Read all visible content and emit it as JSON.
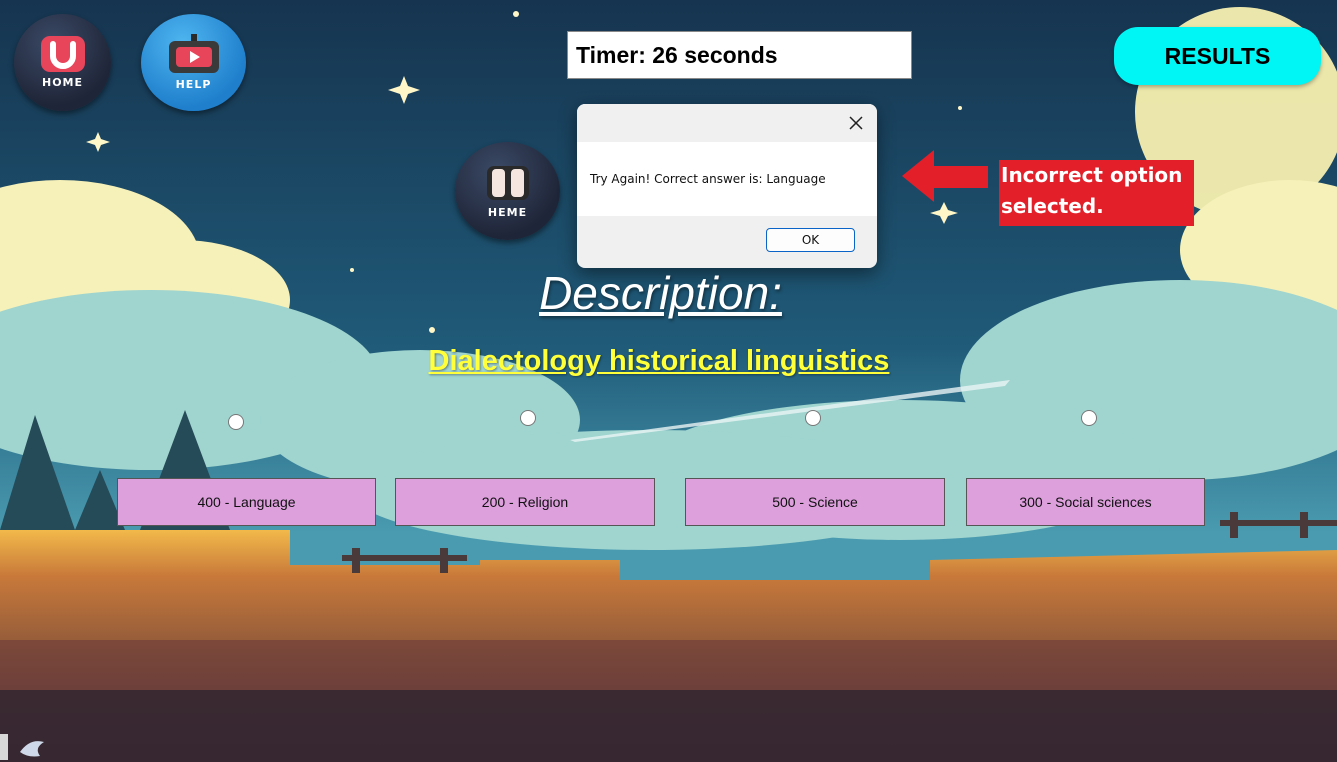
{
  "top_bar": {
    "home_label": "HOME",
    "help_label": "HELP",
    "theme_label": "HEME",
    "timer_text": "Timer: 26 seconds",
    "results_label": "RESULTS"
  },
  "dialog": {
    "message": "Try Again! Correct answer is: Language",
    "ok_label": "OK"
  },
  "annotation": {
    "text": "Incorrect option selected.",
    "color": "#e3202a"
  },
  "quiz": {
    "heading": "Description:",
    "question": "Dialectology  historical linguistics",
    "options": [
      {
        "label": "400 - Language"
      },
      {
        "label": "200 - Religion"
      },
      {
        "label": "500 - Science"
      },
      {
        "label": "300 - Social sciences"
      }
    ]
  },
  "colors": {
    "results_button": "#00f5f5",
    "option_button": "#dda0dd",
    "question_text": "#ffff3a"
  },
  "icons": [
    "home-logo-icon",
    "help-tv-icon",
    "theme-pause-icon",
    "close-icon",
    "arrow-left-icon",
    "corner-app-icon"
  ]
}
